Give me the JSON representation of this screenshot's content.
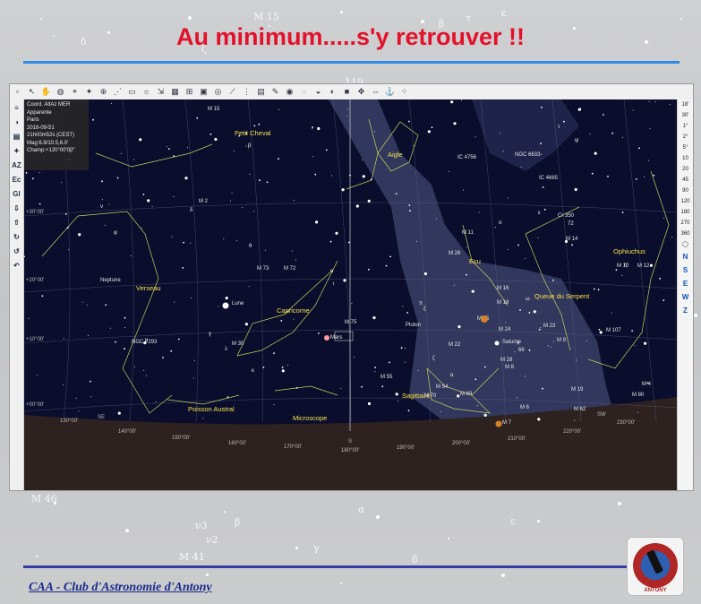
{
  "slide": {
    "title": "Au minimum.....s'y retrouver !!",
    "footer": "CAA - Club d'Astronomie d'Antony",
    "logo_text": "ANTONY",
    "bg_labels": [
      "δ",
      "ζ",
      "M 15",
      "β",
      "τ",
      "ε",
      "119",
      "M 46",
      "ν3",
      "ν2",
      "M 41",
      "β",
      "α",
      "γ",
      "δ",
      "ε"
    ]
  },
  "app": {
    "toolbar_icons": [
      "new-icon",
      "cursor-icon",
      "hand-icon",
      "mouse-icon",
      "target-icon",
      "star-icon",
      "zoom-icon",
      "scale-icon",
      "ruler-icon",
      "bulb-icon",
      "pan-icon",
      "grid-icon",
      "measure-icon",
      "window-icon",
      "compass-icon",
      "telescope-icon",
      "filter-icon",
      "chart-icon",
      "pencil-icon",
      "red-target-icon",
      "orange-target-icon",
      "sky-icon",
      "half-icon",
      "square-icon",
      "arrows-icon",
      "move-icon",
      "anchor-icon",
      "dots-icon"
    ],
    "left_tools": [
      "AZ",
      "Ec",
      "Gl"
    ],
    "right_scale": [
      "18'",
      "30'",
      "1°",
      "2°",
      "5°",
      "10",
      "20",
      "45",
      "90",
      "120",
      "180",
      "270",
      "360"
    ],
    "right_nav": [
      "N",
      "S",
      "E",
      "W",
      "Z"
    ],
    "info": {
      "lines": [
        "Coord. AltAz MER",
        "Apparente",
        "Paris",
        "2018-09-21",
        "21h00m52s (CEST)",
        "Mag:6.9/10.5,6.0'",
        "Champ:+120°00'00\""
      ]
    }
  },
  "map": {
    "constellations": [
      {
        "name": "Petit Cheval"
      },
      {
        "name": "Aigle"
      },
      {
        "name": "Verseau"
      },
      {
        "name": "Capricorne"
      },
      {
        "name": "Ecu"
      },
      {
        "name": "Queue du Serpent"
      },
      {
        "name": "Ophiuchus"
      },
      {
        "name": "Sagittaire"
      },
      {
        "name": "Poisson Austral"
      },
      {
        "name": "Microscope"
      }
    ],
    "objects": [
      {
        "name": "M 15"
      },
      {
        "name": "M 2"
      },
      {
        "name": "NGC 6633"
      },
      {
        "name": "IC 4756"
      },
      {
        "name": "IC 4665"
      },
      {
        "name": "Cr 350"
      },
      {
        "name": "M 11"
      },
      {
        "name": "M 26"
      },
      {
        "name": "M 14"
      },
      {
        "name": "M 10"
      },
      {
        "name": "M 12"
      },
      {
        "name": "M 73"
      },
      {
        "name": "M 72"
      },
      {
        "name": "M 16"
      },
      {
        "name": "M 18"
      },
      {
        "name": "M 25"
      },
      {
        "name": "M 24"
      },
      {
        "name": "M 23"
      },
      {
        "name": "M 107"
      },
      {
        "name": "Neptune"
      },
      {
        "name": "Lune"
      },
      {
        "name": "Mars"
      },
      {
        "name": "NGC 7293"
      },
      {
        "name": "M 30"
      },
      {
        "name": "M 75"
      },
      {
        "name": "Pluton"
      },
      {
        "name": "M 22"
      },
      {
        "name": "Saturne"
      },
      {
        "name": "M 28"
      },
      {
        "name": "M 8"
      },
      {
        "name": "M 9"
      },
      {
        "name": "M 55"
      },
      {
        "name": "M 54"
      },
      {
        "name": "M 70"
      },
      {
        "name": "M 69"
      },
      {
        "name": "M 6"
      },
      {
        "name": "M 7"
      },
      {
        "name": "M 19"
      },
      {
        "name": "M 62"
      },
      {
        "name": "M 80"
      },
      {
        "name": "M 4"
      }
    ],
    "dec_labels": [
      "+30°00'",
      "+20°00'",
      "+10°00'",
      "+00°00'"
    ],
    "az_labels": [
      "130°00'",
      "140°00'",
      "150°00'",
      "160°00'",
      "170°00'",
      "180°00'",
      "190°00'",
      "200°00'",
      "210°00'",
      "220°00'",
      "230°00'"
    ],
    "cardinal": [
      "SE",
      "S",
      "SW"
    ],
    "greek": [
      "α",
      "β",
      "γ",
      "δ",
      "ε",
      "ζ",
      "η",
      "θ",
      "ι",
      "λ",
      "μ",
      "ν",
      "ο",
      "π",
      "σ",
      "τ",
      "φ",
      "ψ",
      "ω",
      "72",
      "χ",
      "ξ",
      "κ",
      "66"
    ],
    "colors": {
      "sky": "#0a0d2c",
      "milkyway": "#3a3f66",
      "ground": "#2e2220",
      "constellation": "#c6cf5e",
      "title": "#e3112b"
    }
  }
}
